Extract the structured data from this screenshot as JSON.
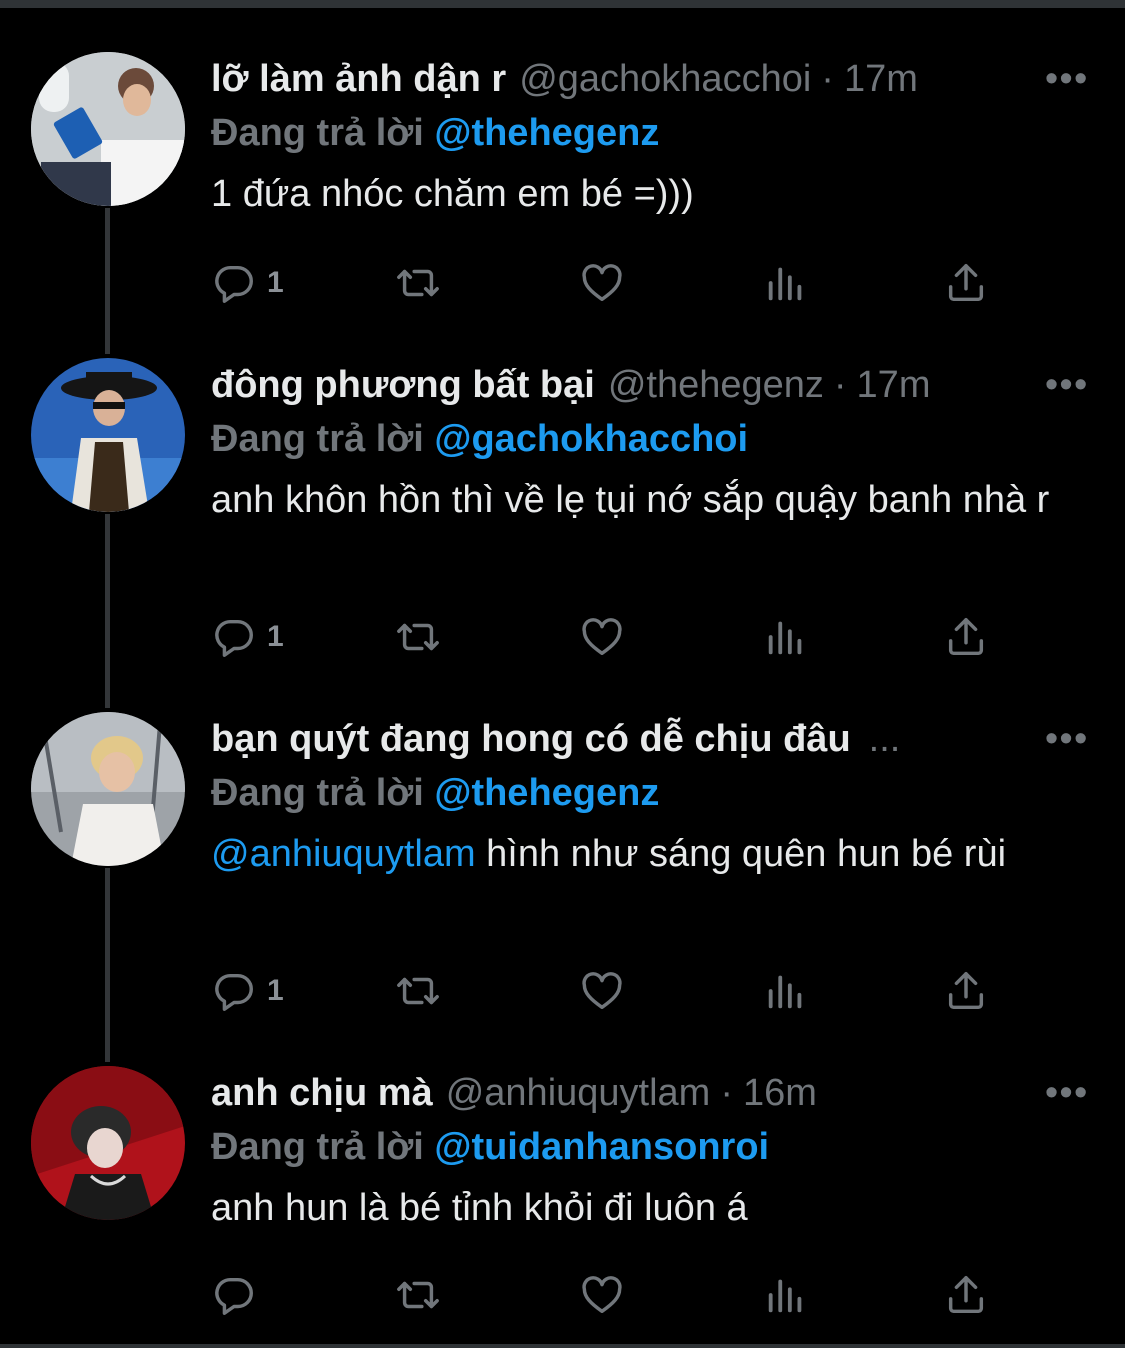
{
  "theme": {
    "background": "#000000",
    "text": "#e7e9ea",
    "muted": "#71767b",
    "link": "#1d9bf0"
  },
  "tweets": [
    {
      "display_name": "lỡ làm ảnh dận r",
      "handle": "@gachokhacchoi",
      "dot": "·",
      "time": "17m",
      "more": "•••",
      "reply_prefix": "Đang trả lời",
      "reply_to": "@thehegenz",
      "text": "1 đứa nhóc chăm em bé =)))",
      "reply_count": "1",
      "icons": [
        "reply-icon",
        "retweet-icon",
        "like-icon",
        "views-icon",
        "share-icon"
      ]
    },
    {
      "display_name": "đông phương bất bại",
      "handle": "@thehegenz",
      "dot": "·",
      "time": "17m",
      "more": "•••",
      "reply_prefix": "Đang trả lời",
      "reply_to": "@gachokhacchoi",
      "text": "anh khôn hồn thì về lẹ tụi nớ sắp quậy banh nhà r",
      "reply_count": "1",
      "icons": [
        "reply-icon",
        "retweet-icon",
        "like-icon",
        "views-icon",
        "share-icon"
      ]
    },
    {
      "display_name": "bạn quýt đang hong có dễ chịu đâu",
      "truncation": "...",
      "more": "•••",
      "reply_prefix": "Đang trả lời",
      "reply_to": "@thehegenz",
      "text_mention": "@anhiuquytlam",
      "text": " hình như sáng quên hun bé rùi",
      "reply_count": "1",
      "icons": [
        "reply-icon",
        "retweet-icon",
        "like-icon",
        "views-icon",
        "share-icon"
      ]
    },
    {
      "display_name": "anh chịu mà",
      "handle": "@anhiuquytlam",
      "dot": "·",
      "time": "16m",
      "more": "•••",
      "reply_prefix": "Đang trả lời",
      "reply_to": "@tuidanhansonroi",
      "text": "anh hun là bé tỉnh khỏi đi luôn á",
      "reply_count": "",
      "icons": [
        "reply-icon",
        "retweet-icon",
        "like-icon",
        "views-icon",
        "share-icon"
      ]
    }
  ]
}
